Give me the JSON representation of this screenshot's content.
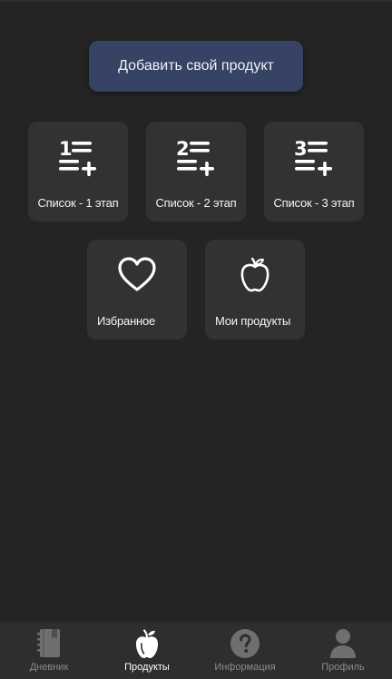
{
  "add_product_button": {
    "label": "Добавить свой продукт"
  },
  "tiles": [
    {
      "label": "Список - 1 этап",
      "icon": "list-1-add-icon",
      "number": "1"
    },
    {
      "label": "Список - 2 этап",
      "icon": "list-2-add-icon",
      "number": "2"
    },
    {
      "label": "Список - 3 этап",
      "icon": "list-3-add-icon",
      "number": "3"
    },
    {
      "label": "Избранное",
      "icon": "heart-icon"
    },
    {
      "label": "Мои продукты",
      "icon": "apple-icon"
    }
  ],
  "bottom_nav": {
    "active_index": 1,
    "items": [
      {
        "label": "Дневник",
        "icon": "notebook-icon"
      },
      {
        "label": "Продукты",
        "icon": "apple-icon"
      },
      {
        "label": "Информация",
        "icon": "question-icon"
      },
      {
        "label": "Профиль",
        "icon": "person-icon"
      }
    ]
  },
  "colors": {
    "background": "#242424",
    "tile": "#323232",
    "accent_button": "#364364",
    "nav_background": "#2e2e2e",
    "nav_inactive": "#8b8b8b",
    "nav_active": "#ffffff"
  }
}
